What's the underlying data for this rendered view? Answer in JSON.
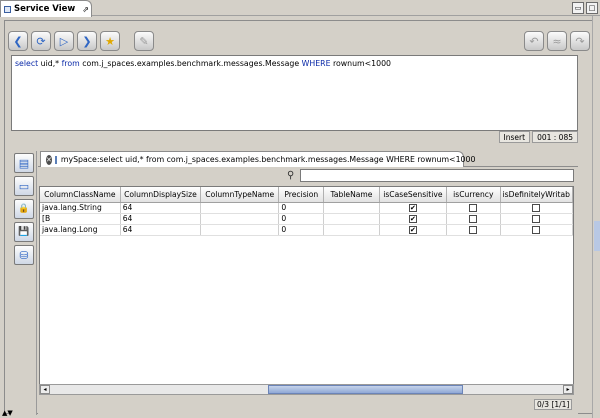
{
  "window": {
    "title": "Service View",
    "pin_glyph": "⇗",
    "restore_glyph": "▭",
    "maximize_glyph": "□"
  },
  "toolbar": {
    "left_buttons": [
      {
        "icon": "back-arrow-icon",
        "glyph": "❮"
      },
      {
        "icon": "refresh-icon",
        "glyph": "⟳"
      },
      {
        "icon": "play-icon",
        "glyph": "▷"
      },
      {
        "icon": "forward-icon",
        "glyph": "❯"
      },
      {
        "icon": "star-icon",
        "glyph": "★"
      },
      {
        "icon": "wand-icon",
        "glyph": "✎"
      }
    ],
    "right_buttons": [
      {
        "icon": "undo-icon",
        "glyph": "↶"
      },
      {
        "icon": "redo-all-icon",
        "glyph": "≈"
      },
      {
        "icon": "redo-icon",
        "glyph": "↷"
      }
    ]
  },
  "editor": {
    "kw_select": "select",
    "text_1": " uid,* ",
    "kw_from": "from",
    "text_2": " com.j_spaces.examples.benchmark.messages.Message ",
    "kw_where": "WHERE",
    "text_3": " rownum<1000"
  },
  "status": {
    "mode": "Insert",
    "position": "001 : 085"
  },
  "side_buttons": [
    {
      "icon": "table-view-icon",
      "glyph": "▤"
    },
    {
      "icon": "console-icon",
      "glyph": "▭"
    },
    {
      "icon": "lock-icon",
      "glyph": "🔒"
    },
    {
      "icon": "floppy-icon",
      "glyph": "💾"
    },
    {
      "icon": "database-icon",
      "glyph": "⛁"
    }
  ],
  "result_tab": {
    "close_glyph": "✕",
    "label": "mySpace:select uid,* from com.j_spaces.examples.benchmark.messages.Message WHERE rownum<1000"
  },
  "search": {
    "glyph": "⚲",
    "value": ""
  },
  "grid": {
    "columns": [
      "ColumnClassName",
      "ColumnDisplaySize",
      "ColumnTypeName",
      "Precision",
      "TableName",
      "isCaseSensitive",
      "isCurrency",
      "isDefinitelyWritab"
    ],
    "rows": [
      {
        "class_name": "java.lang.String",
        "display_size": "64",
        "type_name": "",
        "precision": "0",
        "table_name": "",
        "case_sensitive": true,
        "currency": false,
        "writable": false
      },
      {
        "class_name": "[B",
        "display_size": "64",
        "type_name": "",
        "precision": "0",
        "table_name": "",
        "case_sensitive": true,
        "currency": false,
        "writable": false
      },
      {
        "class_name": "java.lang.Long",
        "display_size": "64",
        "type_name": "",
        "precision": "0",
        "table_name": "",
        "case_sensitive": true,
        "currency": false,
        "writable": false
      }
    ],
    "checkmark_glyph": "✔"
  },
  "scrollbar": {
    "left_glyph": "◂",
    "right_glyph": "▸"
  },
  "pager": {
    "text": "0/3 [1/1]"
  },
  "bottom": {
    "arrows": "▲▼"
  },
  "colors": {
    "background": "#d4d0c8",
    "keyword": "#0b2aa8",
    "scroll_thumb": "#8fa8d6"
  }
}
